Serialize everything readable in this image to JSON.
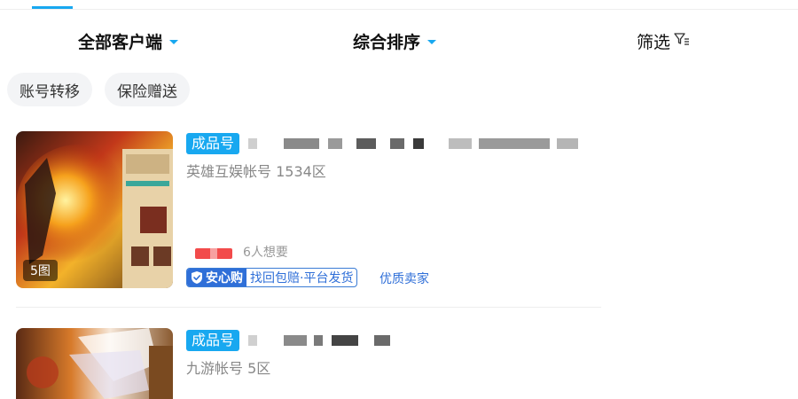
{
  "filters": {
    "client": "全部客户端",
    "sort": "综合排序",
    "screen": "筛选"
  },
  "chips": [
    "账号转移",
    "保险赠送"
  ],
  "listings": [
    {
      "tag": "成品号",
      "account": "英雄互娱帐号 1534区",
      "wants": "6人想要",
      "image_count": "5图",
      "badge_main": "安心购",
      "badge_desc": "找回包赔·平台发货",
      "seller": "优质卖家"
    },
    {
      "tag": "成品号",
      "account": "九游帐号 5区"
    }
  ],
  "colors": {
    "accent": "#18a8f0",
    "badge_blue": "#2f6fd8",
    "price_red": "#f24b4b"
  },
  "icons": {
    "caret": "caret-down-icon",
    "filter": "funnel-icon",
    "shield": "shield-check-icon"
  }
}
